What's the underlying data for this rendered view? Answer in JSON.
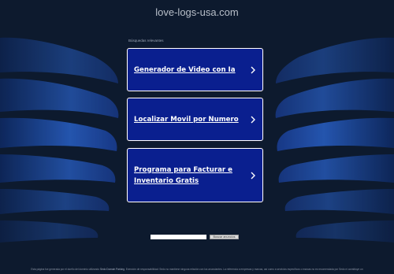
{
  "domain": "love-logs-usa.com",
  "related_label": "Búsquedas relevantes",
  "links": [
    {
      "label": "Generador de Video con Ia"
    },
    {
      "label": "Localizar Movil por Numero"
    },
    {
      "label": "Programa para Facturar e Inventario Gratis"
    }
  ],
  "search": {
    "value": "",
    "button_label": "Buscar anuncios"
  },
  "footer": {
    "text_before": "Esta página fue generada por el dueño del dominio utilizando",
    "link_label": "Sedo Domain Parking",
    "text_after": ". Exención de responsabilidad: Sedo no mantiene ninguna relación con los anunciantes. La referencia a empresas y marcas, así como a servicios específicos o marcas no es recomendada por Sedo ni constituye un"
  },
  "colors": {
    "background": "#0d1a2e",
    "card": "#0a1f8f",
    "wing_light": "#2e6ad6",
    "wing_dark": "#1a3f9a"
  }
}
